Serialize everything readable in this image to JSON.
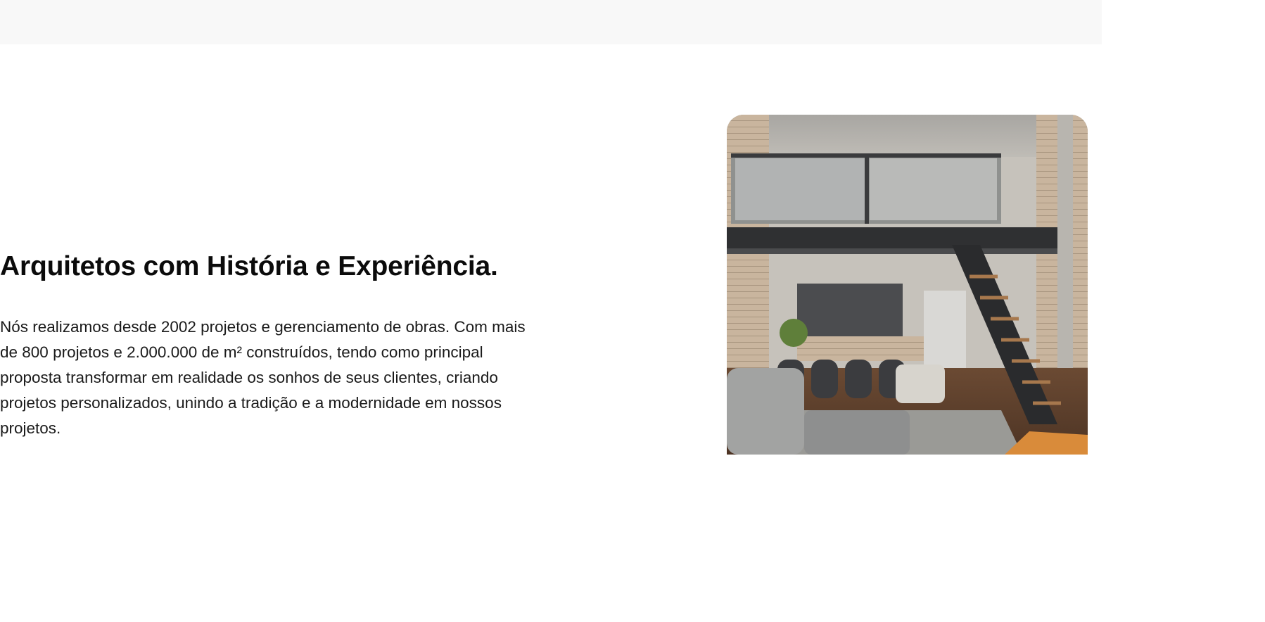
{
  "section": {
    "heading": "Arquitetos com História e Experiência.",
    "paragraph": "Nós realizamos desde 2002 projetos e gerenciamento de obras. Com mais de 800 projetos e 2.000.000 de m² construídos, tendo como principal proposta transformar em realidade os sonhos de seus clientes, criando projetos personalizados, unindo a tradição e a modernidade em nossos projetos."
  },
  "image": {
    "subject": "loft-interior-photo"
  },
  "colors": {
    "top_band": "#f8f8f8",
    "background": "#ffffff",
    "text": "#111111"
  }
}
